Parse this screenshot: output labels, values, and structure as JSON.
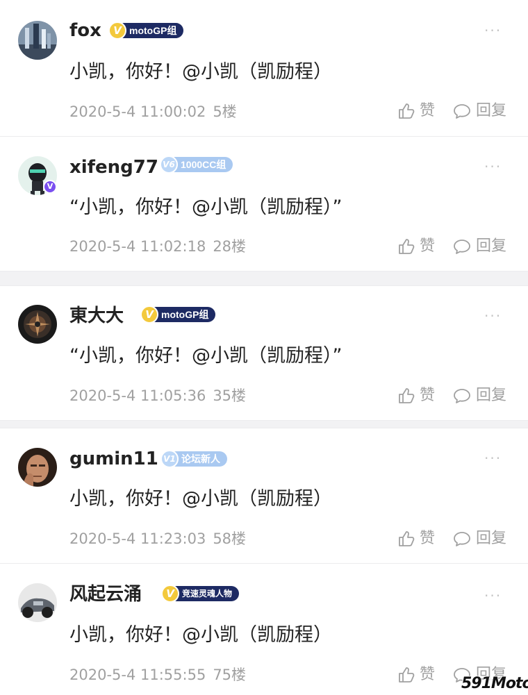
{
  "comments": [
    {
      "username": "fox",
      "badge_v": "V",
      "badge_label": "motoGP组",
      "text": "小凯，你好！@小凯（凯励程）",
      "timestamp": "2020-5-4 11:00:02",
      "floor": "5楼",
      "like_label": "赞",
      "reply_label": "回复"
    },
    {
      "username": "xifeng77",
      "badge_v": "V6",
      "badge_label": "1000CC组",
      "text": "“小凯，你好！@小凯（凯励程）”",
      "timestamp": "2020-5-4 11:02:18",
      "floor": "28楼",
      "like_label": "赞",
      "reply_label": "回复"
    },
    {
      "username": "東大大",
      "badge_v": "V",
      "badge_label": "motoGP组",
      "text": "“小凯，你好！@小凯（凯励程）”",
      "timestamp": "2020-5-4 11:05:36",
      "floor": "35楼",
      "like_label": "赞",
      "reply_label": "回复"
    },
    {
      "username": "gumin11",
      "badge_v": "V1",
      "badge_label": "论坛新人",
      "text": "小凯，你好！@小凯（凯励程）",
      "timestamp": "2020-5-4 11:23:03",
      "floor": "58楼",
      "like_label": "赞",
      "reply_label": "回复"
    },
    {
      "username": "风起云涌",
      "badge_v": "V",
      "badge_label": "竞速灵魂人物",
      "text": "小凯，你好！@小凯（凯励程）",
      "timestamp": "2020-5-4 11:55:55",
      "floor": "75楼",
      "like_label": "赞",
      "reply_label": "回复"
    }
  ],
  "more_label": "···",
  "vip_mark": "V",
  "watermark": "591Moto",
  "colors": {
    "navy_badge": "#1d2a63",
    "light_badge": "#a9c9f1",
    "gold_v": "#f3c93c",
    "meta_gray": "#a0a0a0",
    "vip_purple": "#7a4ff0"
  },
  "icons": {
    "like": "thumbs-up-icon",
    "reply": "speech-bubble-icon",
    "more": "more-dots-icon"
  }
}
